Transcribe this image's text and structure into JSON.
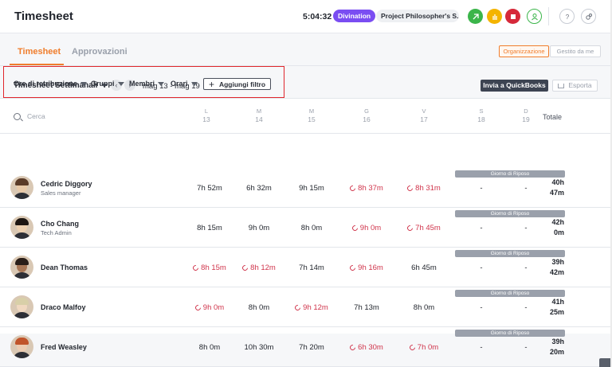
{
  "header": {
    "title": "Timesheet",
    "timer": "5:04:32",
    "tag": "Divination",
    "project": "Project Philosopher's S...",
    "icons": [
      "timer-icon",
      "hand-icon",
      "stop-icon",
      "user-icon",
      "help-icon",
      "settings-icon"
    ]
  },
  "tabs": [
    {
      "label": "Timesheet",
      "active": true
    },
    {
      "label": "Approvazioni",
      "active": false
    }
  ],
  "view_toggle": {
    "org": "Organizzazione",
    "me": "Gestito da me"
  },
  "toolbar": {
    "week_select": "Timesheet Settimanali",
    "date_range": "mag 13 - mag 19",
    "quickbooks": "Invia a QuickBooks",
    "export": "Esporta"
  },
  "filters": {
    "items": [
      "Ore di retribuzione",
      "Gruppi",
      "Membri",
      "Orari"
    ],
    "add": "Aggiungi filtro"
  },
  "table": {
    "search_placeholder": "Cerca",
    "days": [
      {
        "letter": "L",
        "num": "13"
      },
      {
        "letter": "M",
        "num": "14"
      },
      {
        "letter": "M",
        "num": "15"
      },
      {
        "letter": "G",
        "num": "16"
      },
      {
        "letter": "V",
        "num": "17"
      },
      {
        "letter": "S",
        "num": "18"
      },
      {
        "letter": "D",
        "num": "19"
      }
    ],
    "total_label": "Totale",
    "rest_label": "Giorno di Riposo",
    "rows": [
      {
        "name": "Cedric Diggory",
        "role": "Sales manager",
        "cells": [
          "7h 52m",
          "6h 32m",
          "9h 15m",
          "8h 37m",
          "8h 31m",
          "-",
          "-"
        ],
        "overtime": [
          false,
          false,
          false,
          true,
          true,
          false,
          false
        ],
        "total1": "40h",
        "total2": "47m"
      },
      {
        "name": "Cho Chang",
        "role": "Tech Admin",
        "cells": [
          "8h 15m",
          "9h 0m",
          "8h 0m",
          "9h 0m",
          "7h 45m",
          "-",
          "-"
        ],
        "overtime": [
          false,
          false,
          false,
          true,
          true,
          false,
          false
        ],
        "total1": "42h",
        "total2": "0m"
      },
      {
        "name": "Dean Thomas",
        "role": "",
        "cells": [
          "8h 15m",
          "8h 12m",
          "7h 14m",
          "9h 16m",
          "6h 45m",
          "-",
          "-"
        ],
        "overtime": [
          true,
          true,
          false,
          true,
          false,
          false,
          false
        ],
        "total1": "39h",
        "total2": "42m"
      },
      {
        "name": "Draco Malfoy",
        "role": "",
        "cells": [
          "9h 0m",
          "8h 0m",
          "9h 12m",
          "7h 13m",
          "8h 0m",
          "-",
          "-"
        ],
        "overtime": [
          true,
          false,
          true,
          false,
          false,
          false,
          false
        ],
        "total1": "41h",
        "total2": "25m"
      },
      {
        "name": "Fred Weasley",
        "role": "",
        "cells": [
          "8h 0m",
          "10h 30m",
          "7h 20m",
          "6h 30m",
          "7h 0m",
          "-",
          "-"
        ],
        "overtime": [
          false,
          false,
          false,
          true,
          true,
          false,
          false
        ],
        "total1": "39h",
        "total2": "20m"
      }
    ]
  }
}
